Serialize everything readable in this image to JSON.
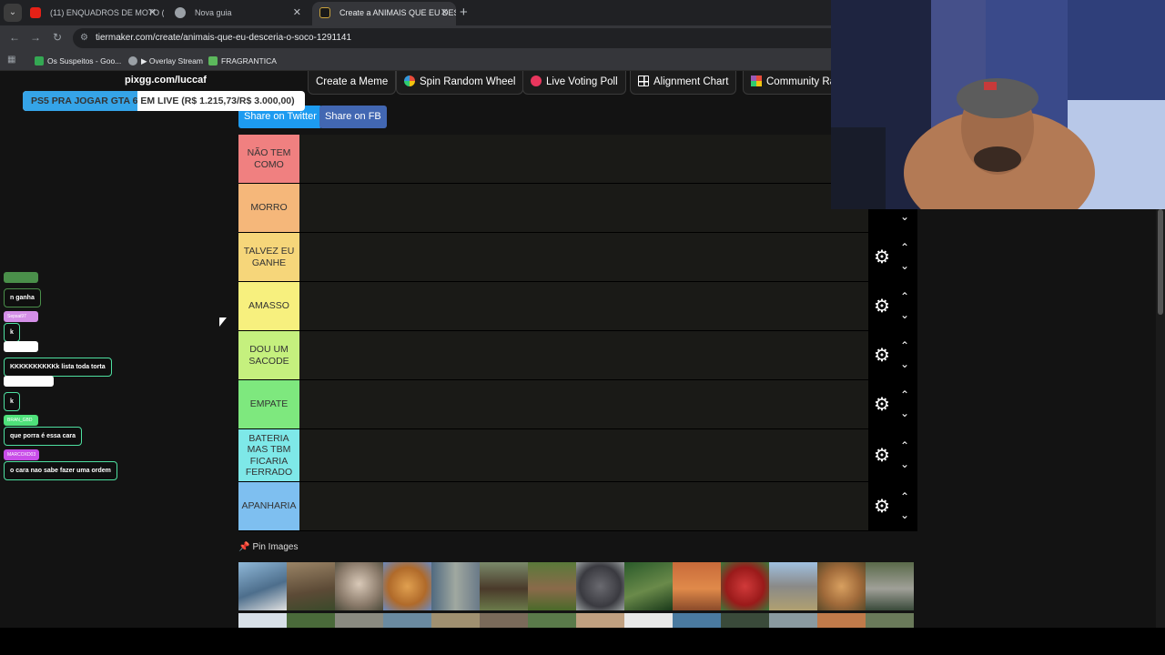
{
  "browser": {
    "tabs": [
      {
        "title": "(11) ENQUADROS DE MOTO (E",
        "active": false
      },
      {
        "title": "Nova guia",
        "active": false
      },
      {
        "title": "Create a ANIMAIS QUE EU DES",
        "active": true
      }
    ],
    "url": "tiermaker.com/create/animais-que-eu-desceria-o-soco-1291141",
    "bookmarks": [
      "Os Suspeitos - Goo...",
      "▶ Overlay Stream",
      "FRAGRANTICA"
    ]
  },
  "overlay": {
    "site": "pixgg.com/luccaf",
    "goal_text": "PS5 PRA JOGAR GTA 6 EM LIVE (R$ 1.215,73/R$ 3.000,00)",
    "goal_progress": 0.405
  },
  "chat": [
    {
      "name": "",
      "name_color": "#4a8f4a",
      "message": "n ganha"
    },
    {
      "name": "Sepsai97",
      "name_color": "#d48fe8",
      "message": "k"
    },
    {
      "name": "",
      "name_color": "#ffffff",
      "message": "KKKKKKKKKKk lista toda torta"
    },
    {
      "name": "",
      "name_color": "#ffffff",
      "message": "k"
    },
    {
      "name": "BRAN_GBD",
      "name_color": "#4ee07a",
      "message": "que porra é essa cara"
    },
    {
      "name": "MARCOXD03",
      "name_color": "#c84de8",
      "message": "o cara nao sabe fazer uma ordem"
    }
  ],
  "top_buttons": [
    "Create a Meme",
    "Spin Random Wheel",
    "Live Voting Poll",
    "Alignment Chart",
    "Community Ra"
  ],
  "share": {
    "twitter": "Share on Twitter",
    "fb": "Share on FB"
  },
  "tiers": [
    {
      "label": "NÃO TEM COMO",
      "color": "#f08080"
    },
    {
      "label": "MORRO",
      "color": "#f5b77a"
    },
    {
      "label": "TALVEZ EU GANHE",
      "color": "#f6d67a"
    },
    {
      "label": "AMASSO",
      "color": "#f7f07e"
    },
    {
      "label": "DOU UM SACODE",
      "color": "#c5f07e"
    },
    {
      "label": "EMPATE",
      "color": "#7ee87e"
    },
    {
      "label": "BATERIA MAS TBM FICARIA FERRADO",
      "color": "#7ee8e8"
    },
    {
      "label": "APANHARIA",
      "color": "#7ebff0"
    }
  ],
  "pin_label": "Pin Images"
}
